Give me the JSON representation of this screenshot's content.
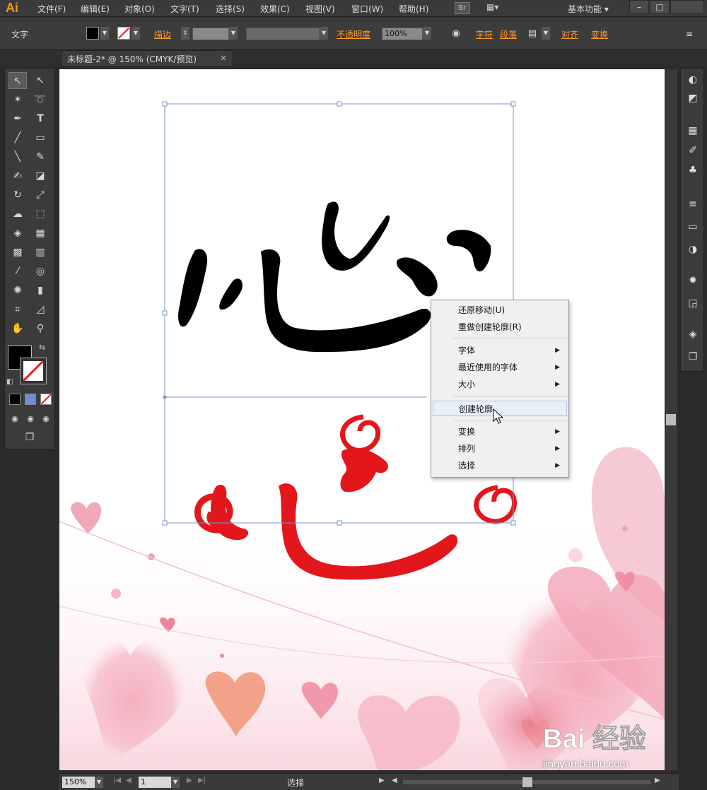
{
  "app": {
    "logo": "Ai"
  },
  "menu": {
    "items": [
      "文件(F)",
      "编辑(E)",
      "对象(O)",
      "文字(T)",
      "选择(S)",
      "效果(C)",
      "视图(V)",
      "窗口(W)",
      "帮助(H)"
    ],
    "bridge": "Br",
    "workspace": "基本功能",
    "window_min": "–",
    "window_max": "□"
  },
  "control": {
    "mode": "文字",
    "stroke_link": "描边",
    "opacity_link": "不透明度",
    "opacity_value": "100%",
    "char_link": "字符",
    "para_link": "段落",
    "align_link": "对齐",
    "transform_link": "变换"
  },
  "tab": {
    "title": "未标题-2* @ 150% (CMYK/预览)",
    "close": "×"
  },
  "context_menu": {
    "items": [
      {
        "label": "还原移动(U)"
      },
      {
        "label": "重做创建轮廓(R)"
      },
      {
        "label": "字体",
        "submenu": true
      },
      {
        "label": "最近使用的字体",
        "submenu": true
      },
      {
        "label": "大小",
        "submenu": true
      },
      {
        "label": "创建轮廓",
        "highlighted": true
      },
      {
        "label": "变换",
        "submenu": true
      },
      {
        "label": "排列",
        "submenu": true
      },
      {
        "label": "选择",
        "submenu": true
      }
    ]
  },
  "status": {
    "zoom": "150%",
    "page": "1",
    "tool": "选择"
  },
  "watermark": {
    "brand": "Bai 经验",
    "url": "jingyan.baidu.com"
  },
  "colors": {
    "accent": "#ff9a2a",
    "glyph_red": "#e3161c",
    "glyph_black": "#000000",
    "selection": "#7a95c9"
  }
}
